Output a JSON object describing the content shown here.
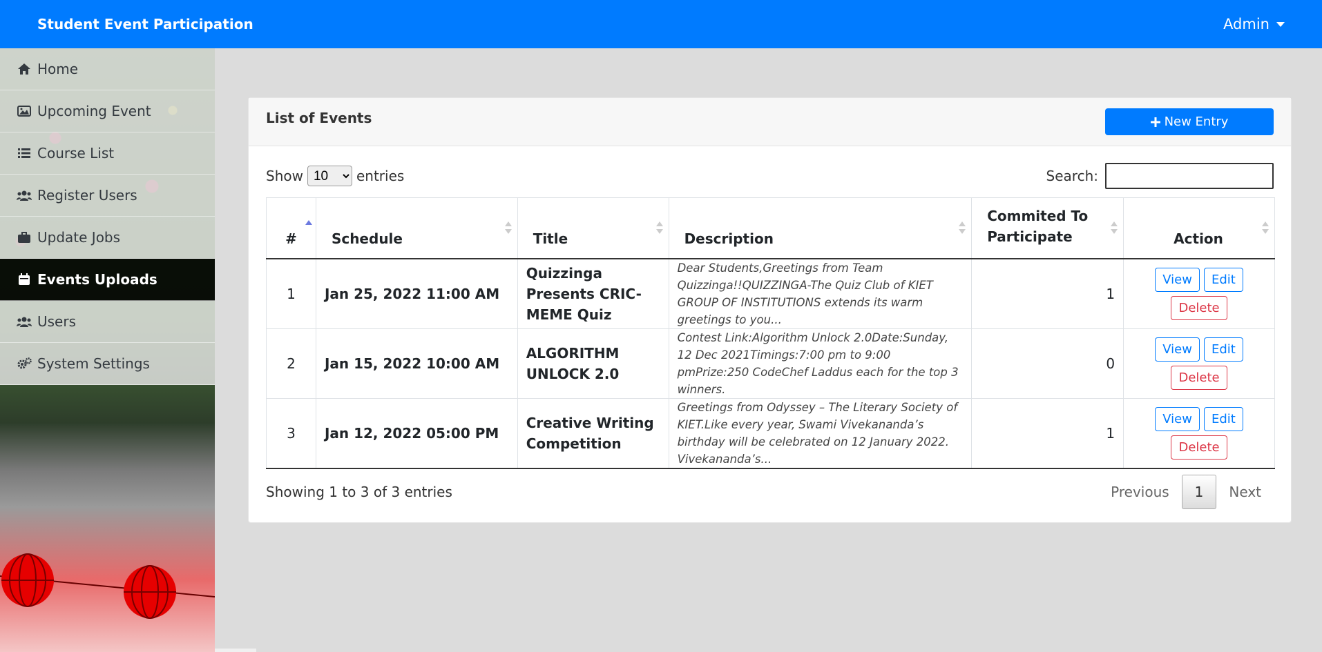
{
  "navbar": {
    "brand": "Student Event Participation",
    "user": "Admin"
  },
  "sidebar": {
    "items": [
      {
        "label": "Home",
        "icon": "home-icon",
        "active": false
      },
      {
        "label": "Upcoming Event",
        "icon": "image-icon",
        "active": false
      },
      {
        "label": "Course List",
        "icon": "list-icon",
        "active": false
      },
      {
        "label": "Register Users",
        "icon": "users-icon",
        "active": false
      },
      {
        "label": "Update Jobs",
        "icon": "briefcase-icon",
        "active": false
      },
      {
        "label": "Events Uploads",
        "icon": "calendar-icon",
        "active": true
      },
      {
        "label": "Users",
        "icon": "users-icon",
        "active": false
      },
      {
        "label": "System Settings",
        "icon": "gears-icon",
        "active": false
      }
    ]
  },
  "card": {
    "title": "List of Events",
    "new_entry_label": "New Entry"
  },
  "controls": {
    "show_label": "Show",
    "entries_label": "entries",
    "page_length": "10",
    "search_label": "Search:",
    "search_value": ""
  },
  "table": {
    "columns": [
      "#",
      "Schedule",
      "Title",
      "Description",
      "Commited To Participate",
      "Action"
    ],
    "rows": [
      {
        "num": "1",
        "schedule": "Jan 25, 2022 11:00 AM",
        "title": "Quizzinga Presents CRIC-MEME Quiz",
        "description": "Dear Students,Greetings from Team Quizzinga!!QUIZZINGA-The Quiz Club of KIET GROUP OF INSTITUTIONS extends its warm greetings to you...",
        "committed": "1"
      },
      {
        "num": "2",
        "schedule": "Jan 15, 2022 10:00 AM",
        "title": "ALGORITHM UNLOCK 2.0",
        "description": "Contest Link:Algorithm Unlock 2.0Date:Sunday, 12 Dec 2021Timings:7:00 pm to 9:00 pmPrize:250 CodeChef Laddus each for the top 3 winners.",
        "committed": "0"
      },
      {
        "num": "3",
        "schedule": "Jan 12, 2022 05:00 PM",
        "title": "Creative Writing Competition",
        "description": "Greetings from Odyssey – The Literary Society of KIET.Like every year, Swami Vivekananda’s birthday will be celebrated on 12 January 2022. Vivekananda’s...",
        "committed": "1"
      }
    ],
    "actions": {
      "view": "View",
      "edit": "Edit",
      "delete": "Delete"
    }
  },
  "footer": {
    "info": "Showing 1 to 3 of 3 entries",
    "previous": "Previous",
    "current_page": "1",
    "next": "Next"
  },
  "colors": {
    "primary": "#007bff",
    "danger": "#dc3545",
    "active_nav": "#000000"
  }
}
